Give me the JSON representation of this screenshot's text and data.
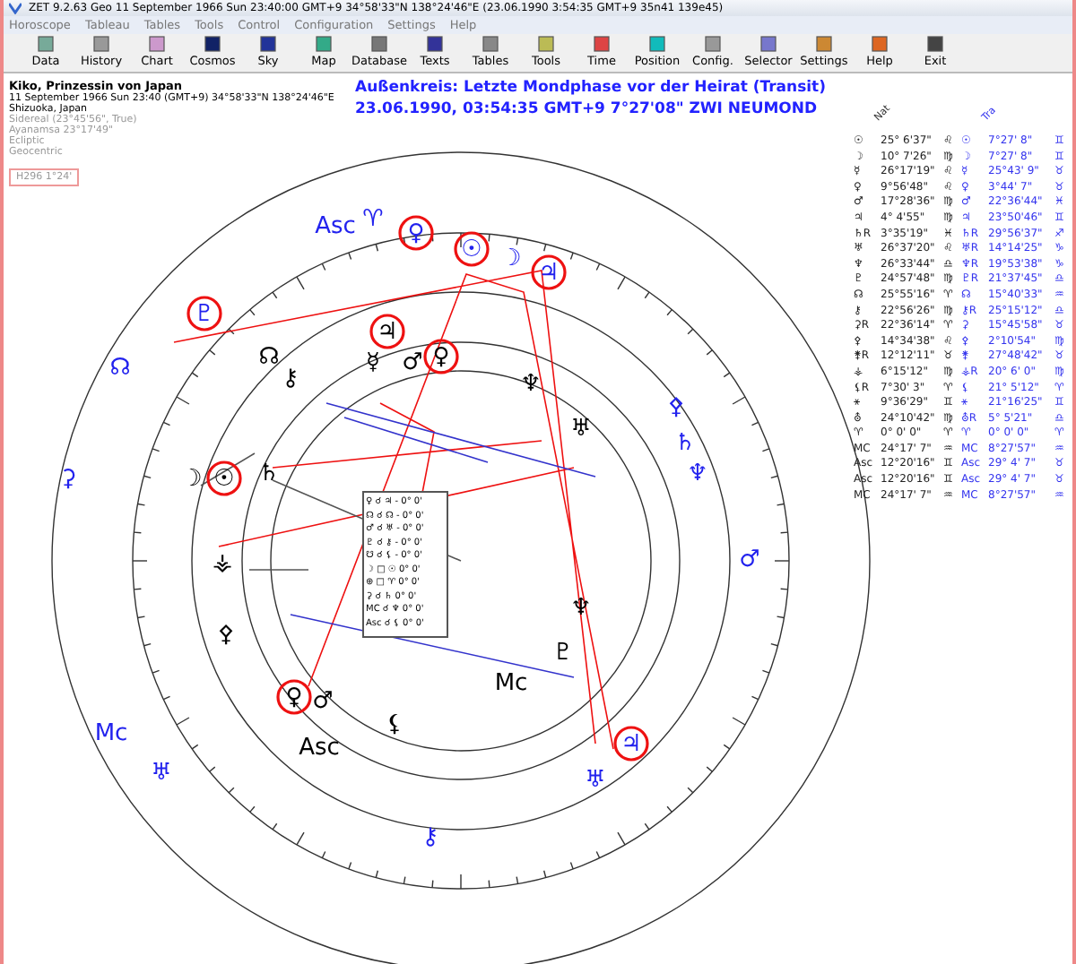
{
  "window": {
    "title": "ZET 9.2.63 Geo   11 September 1966  Sun  23:40:00 GMT+9 34°58'33\"N  138°24'46\"E  (23.06.1990  3:54:35 GMT+9 35n41 139e45)"
  },
  "menu": [
    "Horoscope",
    "Tableau",
    "Tables",
    "Tools",
    "Control",
    "Configuration",
    "Settings",
    "Help"
  ],
  "toolbar": [
    "Data",
    "History",
    "Chart",
    "Cosmos",
    "Sky",
    "Map",
    "Database",
    "Texts",
    "Tables",
    "Tools",
    "Time",
    "Position",
    "Config.",
    "Selector",
    "Settings",
    "Help",
    "Exit"
  ],
  "info": {
    "name": "Kiko, Prinzessin von Japan",
    "date": "11 September 1966  Sun  23:40 (GMT+9) 34°58'33\"N  138°24'46\"E",
    "place": "Shizuoka, Japan",
    "settings": [
      "Sidereal (23°45'56\", True)",
      "Ayanamsa 23°17'49\"",
      "Ecliptic",
      "Geocentric"
    ],
    "house": "H296   1°24'"
  },
  "heading": [
    "Außenkreis: Letzte Mondphase vor der Heirat (Transit)",
    "23.06.1990, 03:54:35 GMT+9   7°27'08\" ZWI    NEUMOND"
  ],
  "positions": {
    "headers": [
      "Nat",
      "Tra"
    ],
    "rows": [
      {
        "natal": [
          "☉",
          "25° 6'37\"",
          "♌"
        ],
        "transit": [
          "☉",
          "7°27' 8\"",
          "♊"
        ]
      },
      {
        "natal": [
          "☽",
          "10° 7'26\"",
          "♍"
        ],
        "transit": [
          "☽",
          "7°27' 8\"",
          "♊"
        ]
      },
      {
        "natal": [
          "☿",
          "26°17'19\"",
          "♌"
        ],
        "transit": [
          "☿",
          "25°43' 9\"",
          "♉"
        ]
      },
      {
        "natal": [
          "♀",
          "9°56'48\"",
          "♌"
        ],
        "transit": [
          "♀",
          "3°44' 7\"",
          "♉"
        ]
      },
      {
        "natal": [
          "♂",
          "17°28'36\"",
          "♍"
        ],
        "transit": [
          "♂",
          "22°36'44\"",
          "♓"
        ]
      },
      {
        "natal": [
          "♃",
          "4° 4'55\"",
          "♍"
        ],
        "transit": [
          "♃",
          "23°50'46\"",
          "♊"
        ]
      },
      {
        "natal": [
          "♄R",
          "3°35'19\"",
          "♓"
        ],
        "transit": [
          "♄R",
          "29°56'37\"",
          "♐"
        ]
      },
      {
        "natal": [
          "♅",
          "26°37'20\"",
          "♌"
        ],
        "transit": [
          "♅R",
          "14°14'25\"",
          "♑"
        ]
      },
      {
        "natal": [
          "♆",
          "26°33'44\"",
          "♎"
        ],
        "transit": [
          "♆R",
          "19°53'38\"",
          "♑"
        ]
      },
      {
        "natal": [
          "♇",
          "24°57'48\"",
          "♍"
        ],
        "transit": [
          "♇R",
          "21°37'45\"",
          "♎"
        ]
      },
      {
        "natal": [
          "☊",
          "25°55'16\"",
          "♈"
        ],
        "transit": [
          "☊",
          "15°40'33\"",
          "♒"
        ]
      },
      {
        "natal": [
          "⚷",
          "22°56'26\"",
          "♍"
        ],
        "transit": [
          "⚷R",
          "25°15'12\"",
          "♎"
        ]
      },
      {
        "natal": [
          "⚳R",
          "22°36'14\"",
          "♈"
        ],
        "transit": [
          "⚳",
          "15°45'58\"",
          "♉"
        ]
      },
      {
        "natal": [
          "⚴",
          "14°34'38\"",
          "♌"
        ],
        "transit": [
          "⚴",
          "2°10'54\"",
          "♍"
        ]
      },
      {
        "natal": [
          "⚵R",
          "12°12'11\"",
          "♉"
        ],
        "transit": [
          "⚵",
          "27°48'42\"",
          "♉"
        ]
      },
      {
        "natal": [
          "⚶",
          "6°15'12\"",
          "♍"
        ],
        "transit": [
          "⚶R",
          "20° 6' 0\"",
          "♍"
        ]
      },
      {
        "natal": [
          "⚸R",
          "7°30' 3\"",
          "♈"
        ],
        "transit": [
          "⚸",
          "21° 5'12\"",
          "♈"
        ]
      },
      {
        "natal": [
          "⚹",
          "9°36'29\"",
          "♊"
        ],
        "transit": [
          "⚹",
          "21°16'25\"",
          "♊"
        ]
      },
      {
        "natal": [
          "⛢",
          "24°10'42\"",
          "♍"
        ],
        "transit": [
          "⛢R",
          "5° 5'21\"",
          "♎"
        ]
      },
      {
        "natal": [
          "♈",
          "0° 0' 0\"",
          "♈"
        ],
        "transit": [
          "♈",
          "0° 0' 0\"",
          "♈"
        ]
      },
      {
        "natal": [
          "MC",
          "24°17' 7\"",
          "♒"
        ],
        "transit": [
          "MC",
          "8°27'57\"",
          "♒"
        ]
      },
      {
        "natal": [
          "Asc",
          "12°20'16\"",
          "♊"
        ],
        "transit": [
          "Asc",
          "29° 4' 7\"",
          "♉"
        ]
      },
      {
        "natal": [
          "Asc",
          "12°20'16\"",
          "♊"
        ],
        "transit": [
          "Asc",
          "29° 4' 7\"",
          "♉"
        ]
      },
      {
        "natal": [
          "MC",
          "24°17' 7\"",
          "♒"
        ],
        "transit": [
          "MC",
          "8°27'57\"",
          "♒"
        ]
      }
    ]
  },
  "wheel": {
    "glyphs": [
      {
        "glyph": "Asc",
        "kind": "transit",
        "circled": false
      },
      {
        "glyph": "♈",
        "kind": "transit",
        "circled": false
      },
      {
        "glyph": "♀",
        "kind": "transit",
        "circled": true
      },
      {
        "glyph": "☉",
        "kind": "transit",
        "circled": true
      },
      {
        "glyph": "☽",
        "kind": "transit",
        "circled": false
      },
      {
        "glyph": "♃",
        "kind": "transit",
        "circled": true
      },
      {
        "glyph": "♇",
        "kind": "transit",
        "circled": true
      },
      {
        "glyph": "☊",
        "kind": "transit",
        "circled": false
      },
      {
        "glyph": "⚳",
        "kind": "transit",
        "circled": false
      },
      {
        "glyph": "⚴",
        "kind": "transit",
        "circled": false
      },
      {
        "glyph": "♄",
        "kind": "transit",
        "circled": false
      },
      {
        "glyph": "♆",
        "kind": "transit",
        "circled": false
      },
      {
        "glyph": "♂",
        "kind": "transit",
        "circled": false
      },
      {
        "glyph": "Mc",
        "kind": "transit",
        "circled": false
      },
      {
        "glyph": "♅",
        "kind": "transit",
        "circled": false
      },
      {
        "glyph": "♃",
        "kind": "transit",
        "circled": true
      },
      {
        "glyph": "♅",
        "kind": "transit",
        "circled": false
      },
      {
        "glyph": "⚷",
        "kind": "transit",
        "circled": false
      },
      {
        "glyph": "☽",
        "kind": "natal",
        "circled": false
      },
      {
        "glyph": "☉",
        "kind": "natal",
        "circled": true
      },
      {
        "glyph": "♄",
        "kind": "natal",
        "circled": false
      },
      {
        "glyph": "☊",
        "kind": "natal",
        "circled": false
      },
      {
        "glyph": "⚷",
        "kind": "natal",
        "circled": false
      },
      {
        "glyph": "♃",
        "kind": "natal",
        "circled": true
      },
      {
        "glyph": "☿",
        "kind": "natal",
        "circled": false
      },
      {
        "glyph": "♂",
        "kind": "natal",
        "circled": false
      },
      {
        "glyph": "♀",
        "kind": "natal",
        "circled": true
      },
      {
        "glyph": "♆",
        "kind": "natal",
        "circled": false
      },
      {
        "glyph": "♅",
        "kind": "natal",
        "circled": false
      },
      {
        "glyph": "⚶",
        "kind": "natal",
        "circled": false
      },
      {
        "glyph": "⚴",
        "kind": "natal",
        "circled": false
      },
      {
        "glyph": "♆",
        "kind": "natal",
        "circled": false
      },
      {
        "glyph": "♇",
        "kind": "natal",
        "circled": false
      },
      {
        "glyph": "Mc",
        "kind": "natal",
        "circled": false
      },
      {
        "glyph": "♀",
        "kind": "natal",
        "circled": true
      },
      {
        "glyph": "♂",
        "kind": "natal",
        "circled": false
      },
      {
        "glyph": "Asc",
        "kind": "natal",
        "circled": false
      },
      {
        "glyph": "⚸",
        "kind": "natal",
        "circled": false
      }
    ],
    "aspects": [
      "♀ ☌ ♃ - 0° 0'",
      "☊ ☌ ☊ - 0° 0'",
      "♂ ☌ ♅ - 0° 0'",
      "♇ ☌ ⚷ - 0° 0'",
      "☋ ☌ ⚸ - 0° 0'",
      "☽ □ ☉  0° 0'",
      "⊕ □ ♈  0° 0'",
      "⚳ ☌ ♄  0° 0'",
      "MC ☌ ♆  0° 0'",
      "Asc ☌ ⚸  0° 0'"
    ]
  }
}
